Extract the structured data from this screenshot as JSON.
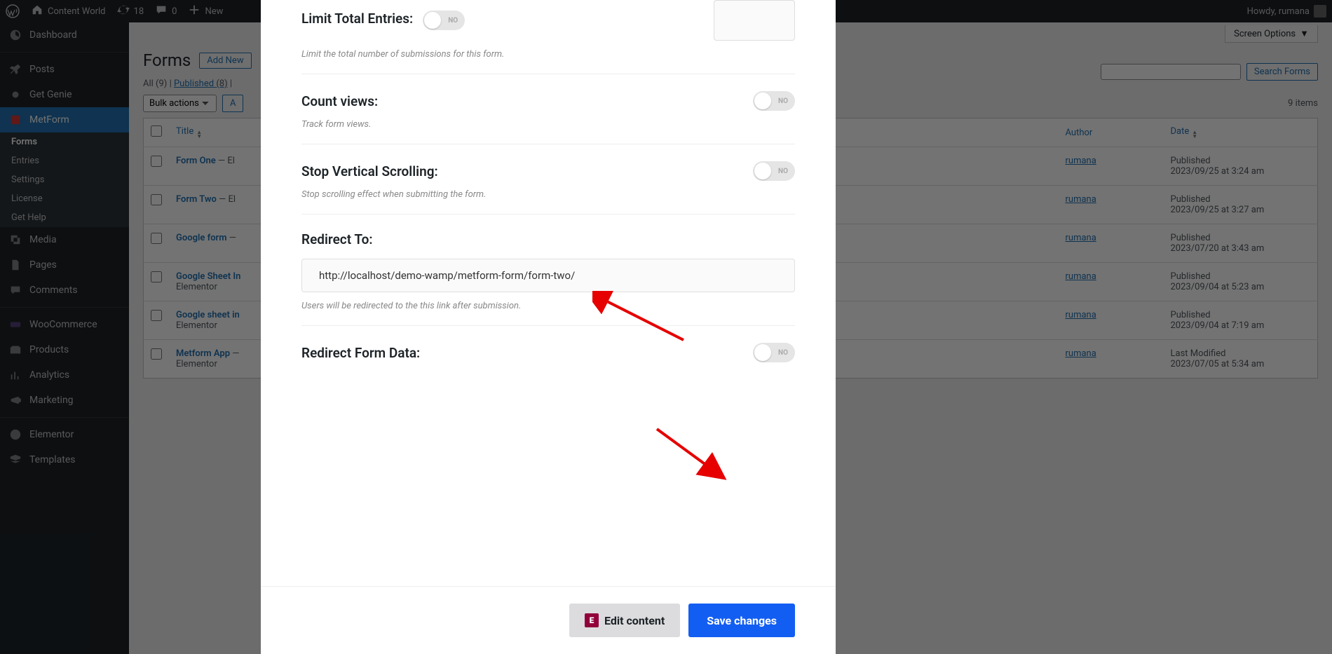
{
  "adminbar": {
    "site_title": "Content World",
    "updates": "18",
    "comments_count": "0",
    "new_label": "New",
    "howdy": "Howdy, rumana"
  },
  "sidebar": {
    "items": [
      {
        "id": "dashboard",
        "label": "Dashboard"
      },
      {
        "id": "posts",
        "label": "Posts"
      },
      {
        "id": "getgenie",
        "label": "Get Genie"
      },
      {
        "id": "metform",
        "label": "MetForm"
      },
      {
        "id": "media",
        "label": "Media"
      },
      {
        "id": "pages",
        "label": "Pages"
      },
      {
        "id": "comments",
        "label": "Comments"
      },
      {
        "id": "woocommerce",
        "label": "WooCommerce"
      },
      {
        "id": "products",
        "label": "Products"
      },
      {
        "id": "analytics",
        "label": "Analytics"
      },
      {
        "id": "marketing",
        "label": "Marketing"
      },
      {
        "id": "elementor",
        "label": "Elementor"
      },
      {
        "id": "templates",
        "label": "Templates"
      }
    ],
    "metform_sub": [
      {
        "label": "Forms",
        "current": true
      },
      {
        "label": "Entries"
      },
      {
        "label": "Settings"
      },
      {
        "label": "License"
      },
      {
        "label": "Get Help"
      }
    ]
  },
  "page": {
    "screen_options": "Screen Options",
    "heading": "Forms",
    "add_new": "Add New",
    "filters": {
      "all": "All",
      "all_count": "(9)",
      "published": "Published",
      "published_count": "(8)",
      "sep": " | "
    },
    "bulk_actions": "Bulk actions",
    "apply": "A",
    "item_count": "9 items",
    "search_label": "Search Forms",
    "columns": {
      "title": "Title",
      "author": "Author",
      "date": "Date"
    },
    "rows": [
      {
        "title": "Form One",
        "suffix": " — El",
        "author": "rumana",
        "status": "Published",
        "datetime": "2023/09/25 at 3:24 am"
      },
      {
        "title": "Form Two",
        "suffix": " — El",
        "author": "rumana",
        "status": "Published",
        "datetime": "2023/09/25 at 3:27 am"
      },
      {
        "title": "Google form",
        "suffix": " — ",
        "author": "rumana",
        "status": "Published",
        "datetime": "2023/07/20 at 3:43 am"
      },
      {
        "title": "Google Sheet In",
        "suffix": "",
        "sub": "Elementor",
        "author": "rumana",
        "status": "Published",
        "datetime": "2023/09/04 at 5:23 am"
      },
      {
        "title": "Google sheet in",
        "suffix": "",
        "sub": "Elementor",
        "author": "rumana",
        "status": "Published",
        "datetime": "2023/09/04 at 7:19 am"
      },
      {
        "title": "Metform App",
        "suffix": " —",
        "sub": "Elementor",
        "author": "rumana",
        "status": "Last Modified",
        "datetime": "2023/07/05 at 5:34 am"
      }
    ]
  },
  "modal": {
    "limit_entries": {
      "label": "Limit Total Entries:",
      "desc": "Limit the total number of submissions for this form.",
      "toggle": "NO"
    },
    "count_views": {
      "label": "Count views:",
      "desc": "Track form views.",
      "toggle": "NO"
    },
    "stop_scroll": {
      "label": "Stop Vertical Scrolling:",
      "desc": "Stop scrolling effect when submitting the form.",
      "toggle": "NO"
    },
    "redirect_to": {
      "label": "Redirect To:",
      "value": "http://localhost/demo-wamp/metform-form/form-two/",
      "desc": "Users will be redirected to the this link after submission."
    },
    "redirect_data": {
      "label": "Redirect Form Data:",
      "toggle": "NO"
    },
    "edit_btn": "Edit content",
    "save_btn": "Save changes"
  }
}
